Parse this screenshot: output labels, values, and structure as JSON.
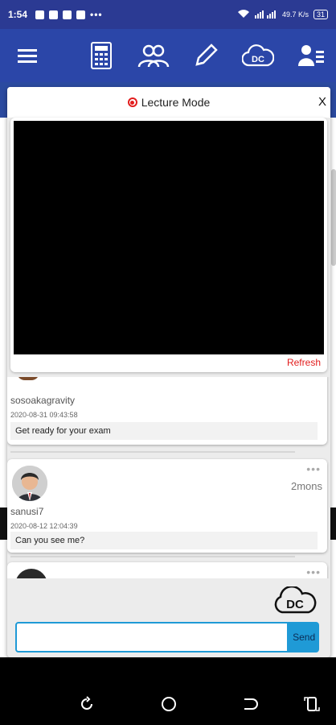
{
  "status_bar": {
    "time": "1:54",
    "network_speed": "49.7 K/s",
    "battery": "31"
  },
  "toolbar": {
    "icons": [
      "menu-icon",
      "calculator-icon",
      "users-icon",
      "pencil-icon",
      "dc-cloud-icon",
      "user-list-icon"
    ]
  },
  "modal": {
    "title": "Lecture Mode",
    "close_label": "X",
    "refresh_label": "Refresh"
  },
  "messages": [
    {
      "username": "sosoakagravity",
      "timestamp": "2020-08-31 09:43:58",
      "text": "Get ready for your exam"
    },
    {
      "username": "sanusi7",
      "timestamp": "2020-08-12 12:04:39",
      "text": "Can you see me?",
      "ago": "2mons",
      "more": "•••"
    },
    {
      "more": "•••"
    }
  ],
  "logo": {
    "text": "DC"
  },
  "composer": {
    "value": "",
    "placeholder": "",
    "send_label": "Send"
  },
  "colors": {
    "app_bar": "#2b46a8",
    "accent": "#1f9ad6",
    "record": "#e21d1d"
  }
}
